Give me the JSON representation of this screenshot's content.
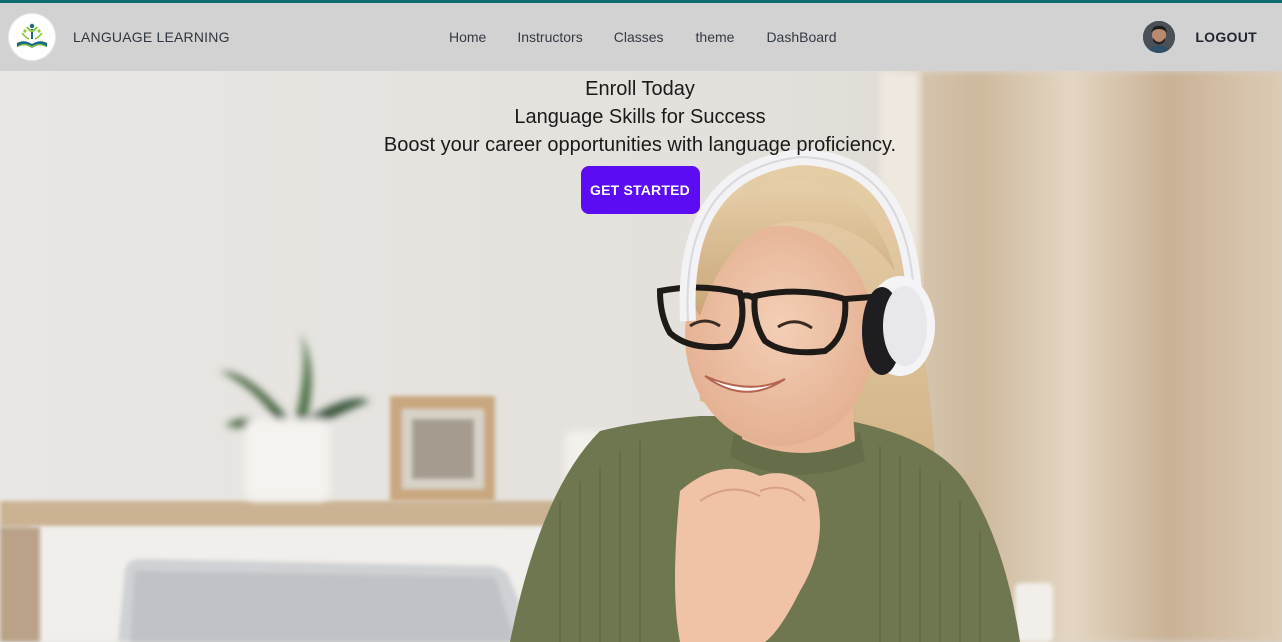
{
  "navbar": {
    "brand_name": "LANGUAGE LEARNING",
    "menu": [
      "Home",
      "Instructors",
      "Classes",
      "theme",
      "DashBoard"
    ],
    "logout_label": "LOGOUT"
  },
  "hero": {
    "line1": "Enroll Today",
    "line2": "Language Skills for Success",
    "line3": "Boost your career opportunities with language proficiency.",
    "cta_label": "GET STARTED"
  },
  "colors": {
    "accent_line": "#0f6b6f",
    "navbar_bg": "#d2d2d2",
    "cta_bg": "#5b0cf2"
  }
}
